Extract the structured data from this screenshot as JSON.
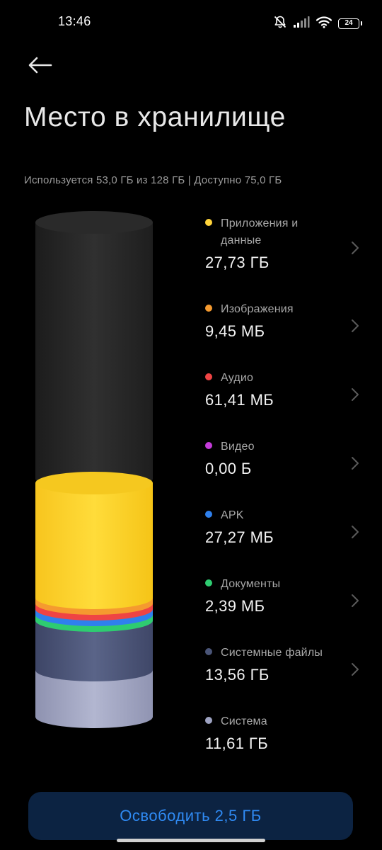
{
  "status_bar": {
    "time": "13:46",
    "battery": "24",
    "icons": [
      "mute-bell-icon",
      "signal-icon",
      "wifi-icon",
      "battery-icon"
    ]
  },
  "header": {
    "back_icon": "arrow-left-icon",
    "title": "Место в хранилище"
  },
  "summary": "Используется 53,0 ГБ из 128 ГБ | Доступно 75,0 ГБ",
  "categories": [
    {
      "label": "Приложения и данные",
      "size": "27,73 ГБ",
      "color": "#ffd43b",
      "chevron": true
    },
    {
      "label": "Изображения",
      "size": "9,45 МБ",
      "color": "#f59a2f",
      "chevron": true
    },
    {
      "label": "Аудио",
      "size": "61,41 МБ",
      "color": "#ef4444",
      "chevron": true
    },
    {
      "label": "Видео",
      "size": "0,00 Б",
      "color": "#c43bd9",
      "chevron": true
    },
    {
      "label": "APK",
      "size": "27,27 МБ",
      "color": "#2f80ed",
      "chevron": true
    },
    {
      "label": "Документы",
      "size": "2,39 МБ",
      "color": "#2ecc71",
      "chevron": true
    },
    {
      "label": "Системные файлы",
      "size": "13,56 ГБ",
      "color": "#4a5578",
      "chevron": true
    },
    {
      "label": "Система",
      "size": "11,61 ГБ",
      "color": "#9ea3c2",
      "chevron": false
    }
  ],
  "free_button": {
    "label": "Освободить 2,5 ГБ"
  },
  "colors": {
    "background": "#000000",
    "accent": "#2f8af3",
    "button_bg": "#0c2342"
  }
}
